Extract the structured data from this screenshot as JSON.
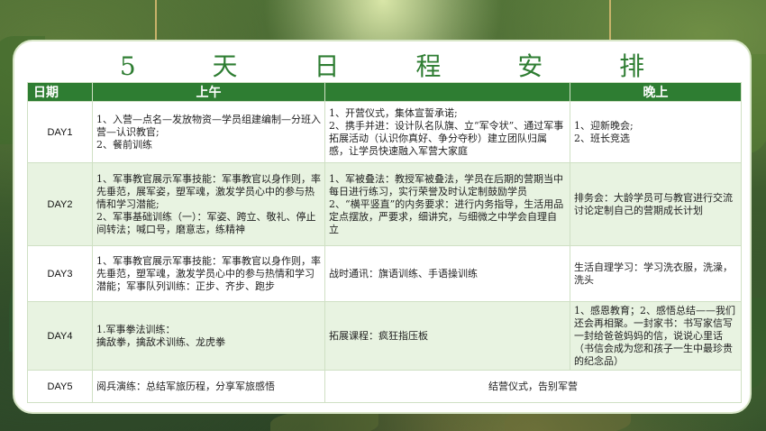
{
  "title": "5 天 日 程 安 排",
  "headers": [
    "日期",
    "上午",
    "",
    "晚上"
  ],
  "rows": [
    {
      "day": "DAY1",
      "am": "1、入营—点名—发放物资—学员组建编制—分班入营—认识教官;\n2、餐前训练",
      "pm": "1、开营仪式，集体宣誓承诺;\n2、携手并进：设计队名队旗、立“军令状”、通过军事拓展活动（认识你真好、争分夺秒）建立团队归属感，让学员快速融入军营大家庭",
      "eve": "1、迎新晚会;\n2、班长竞选"
    },
    {
      "day": "DAY2",
      "am": "1、军事教官展示军事技能：军事教官以身作则，率先垂范，展军姿，塑军魂，激发学员心中的参与热情和学习潜能;\n2、军事基础训练（一）：军姿、跨立、敬礼、停止间转法；喊口号，磨意志，练精神",
      "pm": "1、军被叠法：教授军被叠法，学员在后期的营期当中每日进行练习，实行荣誉及时认定制鼓励学员\n2、“横平竖直”的内务要求：进行内务指导，生活用品定点摆放，严要求，细讲究，与细微之中学会自理自立",
      "eve": "排务会：大龄学员可与教官进行交流讨论定制自己的营期成长计划"
    },
    {
      "day": "DAY3",
      "am": "1、军事教官展示军事技能：军事教官以身作则，率先垂范，塑军魂，激发学员心中的参与热情和学习潜能；军事队列训练：正步、齐步、跑步",
      "pm": "战时通讯：旗语训练、手语操训练",
      "eve": "生活自理学习：学习洗衣服，洗澡，洗头"
    },
    {
      "day": "DAY4",
      "am": "1.军事拳法训练：\n擒敌拳，擒敌术训练、龙虎拳",
      "pm": "拓展课程：疯狂指压板",
      "eve": "1、感恩教育；2、感悟总结——我们还会再相聚。一封家书：书写家信写一封给爸爸妈妈的信，说说心里话（书信会成为您和孩子一生中最珍贵的纪念品）"
    },
    {
      "day": "DAY5",
      "am": "阅兵演练：总结军旅历程，分享军旅感悟",
      "pm_eve": "结营仪式，告别军营"
    }
  ],
  "colors": {
    "header_green": "#2e7d32",
    "row_tint": "#e8f3e1",
    "title_green": "#2e7d32"
  }
}
